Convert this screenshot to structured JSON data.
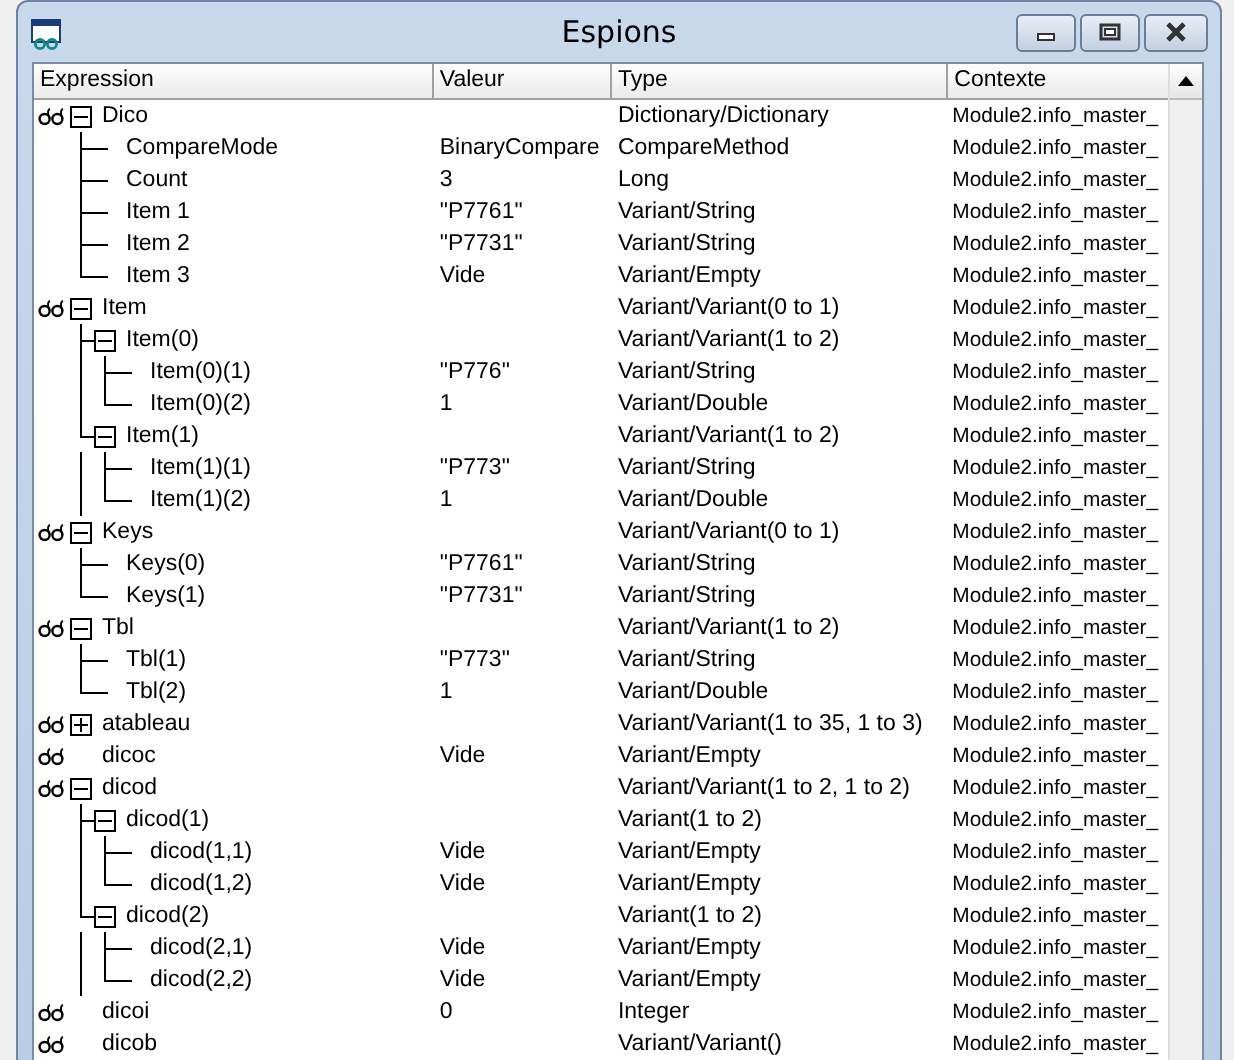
{
  "window": {
    "title": "Espions"
  },
  "columns": [
    "Expression",
    "Valeur",
    "Type",
    "Contexte"
  ],
  "rows": [
    {
      "expression": "Dico",
      "type": "Dictionary/Dictionary",
      "context": "Module2.info_master_",
      "expanded": true,
      "children": [
        {
          "expression": "CompareMode",
          "value": "BinaryCompare",
          "type": "CompareMethod",
          "context": "Module2.info_master_"
        },
        {
          "expression": "Count",
          "value": "3",
          "type": "Long",
          "context": "Module2.info_master_"
        },
        {
          "expression": "Item 1",
          "value": "\"P7761\"",
          "type": "Variant/String",
          "context": "Module2.info_master_"
        },
        {
          "expression": "Item 2",
          "value": "\"P7731\"",
          "type": "Variant/String",
          "context": "Module2.info_master_"
        },
        {
          "expression": "Item 3",
          "value": "Vide",
          "type": "Variant/Empty",
          "context": "Module2.info_master_"
        }
      ]
    },
    {
      "expression": "Item",
      "type": "Variant/Variant(0 to 1)",
      "context": "Module2.info_master_",
      "expanded": true,
      "children": [
        {
          "expression": "Item(0)",
          "type": "Variant/Variant(1 to 2)",
          "context": "Module2.info_master_",
          "expanded": true,
          "children": [
            {
              "expression": "Item(0)(1)",
              "value": "\"P776\"",
              "type": "Variant/String",
              "context": "Module2.info_master_"
            },
            {
              "expression": "Item(0)(2)",
              "value": "1",
              "type": "Variant/Double",
              "context": "Module2.info_master_"
            }
          ]
        },
        {
          "expression": "Item(1)",
          "type": "Variant/Variant(1 to 2)",
          "context": "Module2.info_master_",
          "expanded": true,
          "children": [
            {
              "expression": "Item(1)(1)",
              "value": "\"P773\"",
              "type": "Variant/String",
              "context": "Module2.info_master_"
            },
            {
              "expression": "Item(1)(2)",
              "value": "1",
              "type": "Variant/Double",
              "context": "Module2.info_master_"
            }
          ]
        }
      ]
    },
    {
      "expression": "Keys",
      "type": "Variant/Variant(0 to 1)",
      "context": "Module2.info_master_",
      "expanded": true,
      "children": [
        {
          "expression": "Keys(0)",
          "value": "\"P7761\"",
          "type": "Variant/String",
          "context": "Module2.info_master_"
        },
        {
          "expression": "Keys(1)",
          "value": "\"P7731\"",
          "type": "Variant/String",
          "context": "Module2.info_master_"
        }
      ]
    },
    {
      "expression": "Tbl",
      "type": "Variant/Variant(1 to 2)",
      "context": "Module2.info_master_",
      "expanded": true,
      "children": [
        {
          "expression": "Tbl(1)",
          "value": "\"P773\"",
          "type": "Variant/String",
          "context": "Module2.info_master_"
        },
        {
          "expression": "Tbl(2)",
          "value": "1",
          "type": "Variant/Double",
          "context": "Module2.info_master_"
        }
      ]
    },
    {
      "expression": "atableau",
      "type": "Variant/Variant(1 to 35, 1 to 3)",
      "context": "Module2.info_master_",
      "expanded": false
    },
    {
      "expression": "dicoc",
      "value": "Vide",
      "type": "Variant/Empty",
      "context": "Module2.info_master_"
    },
    {
      "expression": "dicod",
      "type": "Variant/Variant(1 to 2, 1 to 2)",
      "context": "Module2.info_master_",
      "expanded": true,
      "children": [
        {
          "expression": "dicod(1)",
          "type": "Variant(1 to 2)",
          "context": "Module2.info_master_",
          "expanded": true,
          "children": [
            {
              "expression": "dicod(1,1)",
              "value": "Vide",
              "type": "Variant/Empty",
              "context": "Module2.info_master_"
            },
            {
              "expression": "dicod(1,2)",
              "value": "Vide",
              "type": "Variant/Empty",
              "context": "Module2.info_master_"
            }
          ]
        },
        {
          "expression": "dicod(2)",
          "type": "Variant(1 to 2)",
          "context": "Module2.info_master_",
          "expanded": true,
          "children": [
            {
              "expression": "dicod(2,1)",
              "value": "Vide",
              "type": "Variant/Empty",
              "context": "Module2.info_master_"
            },
            {
              "expression": "dicod(2,2)",
              "value": "Vide",
              "type": "Variant/Empty",
              "context": "Module2.info_master_"
            }
          ]
        }
      ]
    },
    {
      "expression": "dicoi",
      "value": "0",
      "type": "Integer",
      "context": "Module2.info_master_"
    },
    {
      "expression": "dicob",
      "type": "Variant/Variant()",
      "context": "Module2.info_master_"
    }
  ]
}
